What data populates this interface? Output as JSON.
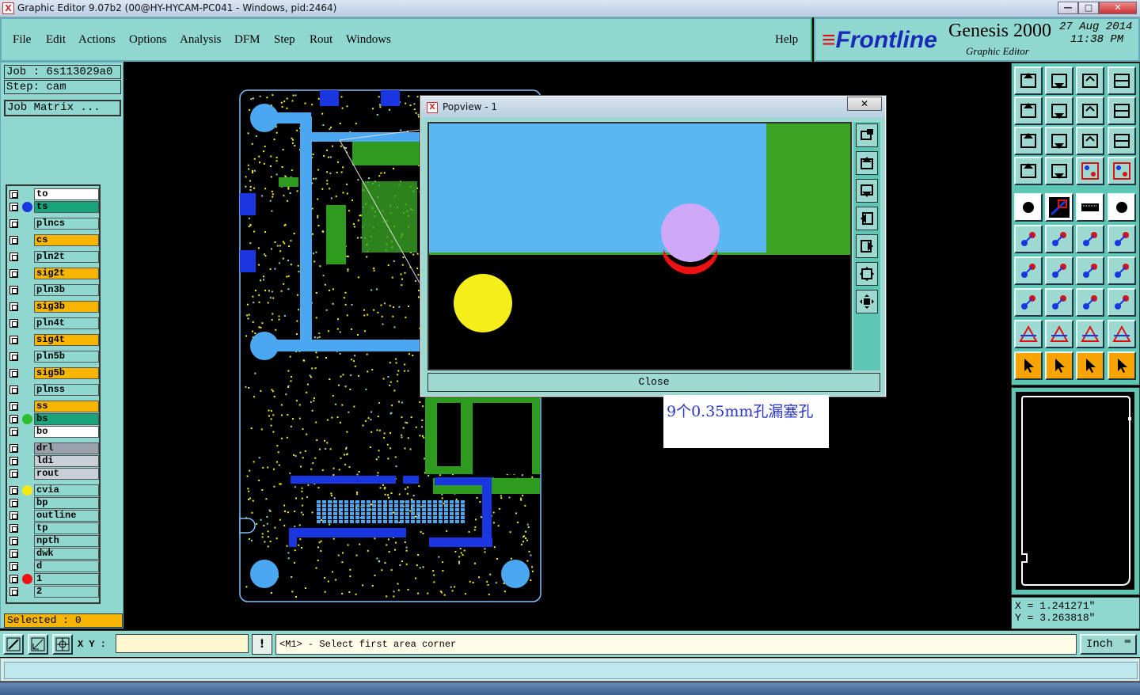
{
  "window": {
    "title": "Graphic Editor 9.07b2 (00@HY-HYCAM-PC041 - Windows, pid:2464)",
    "minimize": "—",
    "maximize": "□",
    "close": "✕"
  },
  "menu": {
    "file": "File",
    "edit": "Edit",
    "actions": "Actions",
    "options": "Options",
    "analysis": "Analysis",
    "dfm": "DFM",
    "step": "Step",
    "rout": "Rout",
    "windows": "Windows",
    "help": "Help"
  },
  "brand": {
    "logo": "Frontline",
    "product": "Genesis 2000",
    "subtitle": "Graphic Editor",
    "date": "27 Aug 2014",
    "time": "11:38 PM"
  },
  "job": {
    "job_line": "Job : 6s113029a0",
    "step_line": "Step: cam",
    "matrix_button": "Job Matrix ..."
  },
  "layers": [
    {
      "name": "to",
      "color": "#ffffff",
      "dot": ""
    },
    {
      "name": "ts",
      "color": "#1aa37a",
      "dot": "#1a36e0"
    },
    {
      "name": "plncs",
      "color": "#8fd7cf",
      "dot": ""
    },
    {
      "name": "cs",
      "color": "#f7b500",
      "dot": ""
    },
    {
      "name": "pln2t",
      "color": "#8fd7cf",
      "dot": ""
    },
    {
      "name": "sig2t",
      "color": "#f7b500",
      "dot": ""
    },
    {
      "name": "pln3b",
      "color": "#8fd7cf",
      "dot": ""
    },
    {
      "name": "sig3b",
      "color": "#f7b500",
      "dot": ""
    },
    {
      "name": "pln4t",
      "color": "#8fd7cf",
      "dot": ""
    },
    {
      "name": "sig4t",
      "color": "#f7b500",
      "dot": ""
    },
    {
      "name": "pln5b",
      "color": "#8fd7cf",
      "dot": ""
    },
    {
      "name": "sig5b",
      "color": "#f7b500",
      "dot": ""
    },
    {
      "name": "plnss",
      "color": "#8fd7cf",
      "dot": ""
    },
    {
      "name": "ss",
      "color": "#f7b500",
      "dot": ""
    },
    {
      "name": "bs",
      "color": "#1aa37a",
      "dot": "#2bbd2b"
    },
    {
      "name": "bo",
      "color": "#ffffff",
      "dot": ""
    },
    {
      "name": "drl",
      "color": "#9aa3ad",
      "dot": ""
    },
    {
      "name": "ldi",
      "color": "#c9cfd6",
      "dot": ""
    },
    {
      "name": "rout",
      "color": "#c9cfd6",
      "dot": ""
    },
    {
      "name": "cvia",
      "color": "#8fd7cf",
      "dot": "#f5ea10"
    },
    {
      "name": "bp",
      "color": "#8fd7cf",
      "dot": ""
    },
    {
      "name": "outline",
      "color": "#8fd7cf",
      "dot": ""
    },
    {
      "name": "tp",
      "color": "#8fd7cf",
      "dot": ""
    },
    {
      "name": "npth",
      "color": "#8fd7cf",
      "dot": ""
    },
    {
      "name": "dwk",
      "color": "#8fd7cf",
      "dot": ""
    },
    {
      "name": "d",
      "color": "#8fd7cf",
      "dot": ""
    },
    {
      "name": "1",
      "color": "#8fd7cf",
      "dot": "#ee1111"
    },
    {
      "name": "2",
      "color": "#8fd7cf",
      "dot": ""
    }
  ],
  "selected": "Selected : 0",
  "popview": {
    "title": "Popview - 1",
    "close_x": "✕",
    "close_button": "Close"
  },
  "note": "9个0.35mm孔漏塞孔",
  "coords": {
    "x": "X = 1.241271\"",
    "y": "Y = 3.263818\""
  },
  "bottom": {
    "xy_label": "X Y :",
    "xy_value": "",
    "bang": "!",
    "prompt": "<M1> - Select first area corner",
    "units": "Inch",
    "units_arrow": "═"
  }
}
